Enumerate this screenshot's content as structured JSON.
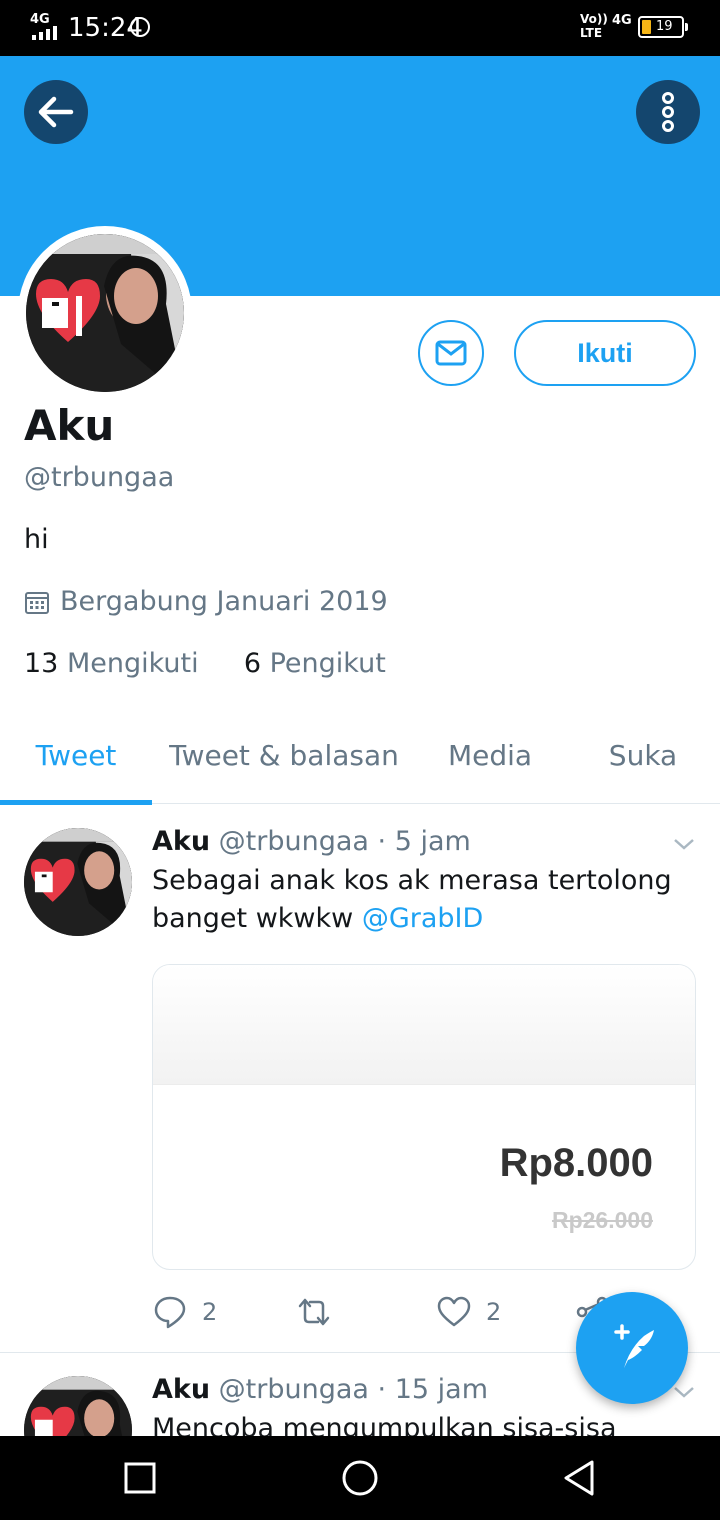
{
  "status_bar": {
    "network": "4G",
    "time": "15:24",
    "volte": "Vo))",
    "lte": "LTE",
    "network_right": "4G",
    "battery": "19"
  },
  "profile": {
    "name": "Aku",
    "handle": "@trbungaa",
    "bio": "hi",
    "joined": "Bergabung Januari 2019",
    "following_count": "13",
    "following_label": "Mengikuti",
    "followers_count": "6",
    "followers_label": "Pengikut",
    "follow_label": "Ikuti"
  },
  "tabs": [
    "Tweet",
    "Tweet & balasan",
    "Media",
    "Suka"
  ],
  "tweets": [
    {
      "name": "Aku",
      "handle": "@trbungaa",
      "time": "· 5 jam",
      "text_line1": "Sebagai anak kos ak merasa tertolong",
      "text_line2": "banget wkwkw ",
      "mention": "@GrabID",
      "card_price": "Rp8.000",
      "card_old_price": "Rp26.000",
      "replies": "2",
      "likes": "2"
    },
    {
      "name": "Aku",
      "handle": "@trbungaa",
      "time": "· 15 jam",
      "text_line1": "Mencoba mengumpulkan sisa-sisa logika"
    }
  ],
  "colors": {
    "accent": "#1da1f2",
    "header_button": "#14466e",
    "secondary_text": "#657786"
  }
}
